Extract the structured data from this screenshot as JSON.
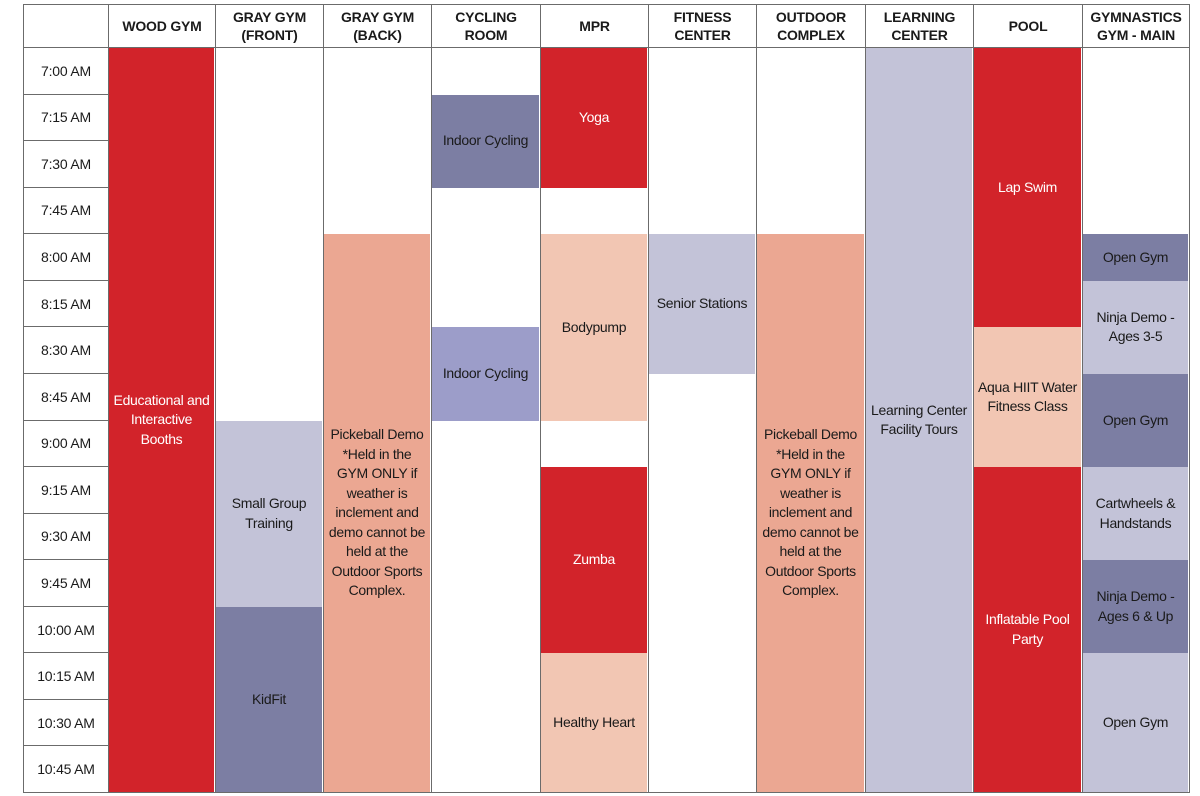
{
  "schedule": {
    "colors": {
      "red": "#D2232A",
      "salmon": "#EBA792",
      "peach": "#F2C6B3",
      "lavender": "#C3C3D8",
      "slate": "#7C7EA3",
      "periwinkle": "#9C9DC9",
      "grid_line": "#6B6B6B"
    },
    "times": [
      "7:00 AM",
      "7:15 AM",
      "7:30 AM",
      "7:45 AM",
      "8:00 AM",
      "8:15 AM",
      "8:30 AM",
      "8:45 AM",
      "9:00 AM",
      "9:15 AM",
      "9:30 AM",
      "9:45 AM",
      "10:00 AM",
      "10:15 AM",
      "10:30 AM",
      "10:45 AM"
    ],
    "rooms": [
      {
        "name": "WOOD GYM",
        "events": [
          {
            "label": "Educational and Interactive Booths",
            "start": "7:00 AM",
            "end": "11:00 AM",
            "color": "red"
          }
        ]
      },
      {
        "name": "GRAY GYM (FRONT)",
        "events": [
          {
            "label": "Small Group Training",
            "start": "9:00 AM",
            "end": "10:00 AM",
            "color": "lavender"
          },
          {
            "label": "KidFit",
            "start": "10:00 AM",
            "end": "11:00 AM",
            "color": "slate"
          }
        ]
      },
      {
        "name": "GRAY GYM (BACK)",
        "events": [
          {
            "label": "Pickeball Demo *Held in the GYM ONLY if weather is inclement and demo cannot be held at the Outdoor Sports Complex.",
            "start": "8:00 AM",
            "end": "11:00 AM",
            "color": "salmon"
          }
        ]
      },
      {
        "name": "CYCLING ROOM",
        "events": [
          {
            "label": "Indoor Cycling",
            "start": "7:15 AM",
            "end": "7:45 AM",
            "color": "slate"
          },
          {
            "label": "Indoor Cycling",
            "start": "8:30 AM",
            "end": "9:00 AM",
            "color": "periwinkle"
          }
        ]
      },
      {
        "name": "MPR",
        "events": [
          {
            "label": "Yoga",
            "start": "7:00 AM",
            "end": "7:45 AM",
            "color": "red"
          },
          {
            "label": "Bodypump",
            "start": "8:00 AM",
            "end": "9:00 AM",
            "color": "peach"
          },
          {
            "label": "Zumba",
            "start": "9:15 AM",
            "end": "10:15 AM",
            "color": "red"
          },
          {
            "label": "Healthy Heart",
            "start": "10:15 AM",
            "end": "11:00 AM",
            "color": "peach"
          }
        ]
      },
      {
        "name": "FITNESS CENTER",
        "events": [
          {
            "label": "Senior Stations",
            "start": "8:00 AM",
            "end": "8:45 AM",
            "color": "lavender"
          }
        ]
      },
      {
        "name": "OUTDOOR COMPLEX",
        "events": [
          {
            "label": "Pickeball Demo *Held in the GYM ONLY if weather is inclement and demo cannot be held at the Outdoor Sports Complex.",
            "start": "8:00 AM",
            "end": "11:00 AM",
            "color": "salmon"
          }
        ]
      },
      {
        "name": "LEARNING CENTER",
        "events": [
          {
            "label": "Learning Center Facility Tours",
            "start": "7:00 AM",
            "end": "11:00 AM",
            "color": "lavender"
          }
        ]
      },
      {
        "name": "POOL",
        "events": [
          {
            "label": "Lap Swim",
            "start": "7:00 AM",
            "end": "8:30 AM",
            "color": "red"
          },
          {
            "label": "Aqua HIIT Water Fitness Class",
            "start": "8:30 AM",
            "end": "9:15 AM",
            "color": "peach"
          },
          {
            "label": "Inflatable Pool Party",
            "start": "9:15 AM",
            "end": "11:00 AM",
            "color": "red"
          }
        ]
      },
      {
        "name": "GYMNASTICS GYM - MAIN",
        "events": [
          {
            "label": "Open Gym",
            "start": "8:00 AM",
            "end": "8:15 AM",
            "color": "slate"
          },
          {
            "label": "Ninja Demo - Ages 3-5",
            "start": "8:15 AM",
            "end": "8:45 AM",
            "color": "lavender"
          },
          {
            "label": "Open Gym",
            "start": "8:45 AM",
            "end": "9:15 AM",
            "color": "slate"
          },
          {
            "label": "Cartwheels & Handstands",
            "start": "9:15 AM",
            "end": "9:45 AM",
            "color": "lavender"
          },
          {
            "label": "Ninja Demo - Ages 6 & Up",
            "start": "9:45 AM",
            "end": "10:15 AM",
            "color": "slate"
          },
          {
            "label": "Open Gym",
            "start": "10:15 AM",
            "end": "11:00 AM",
            "color": "lavender"
          }
        ]
      }
    ]
  }
}
